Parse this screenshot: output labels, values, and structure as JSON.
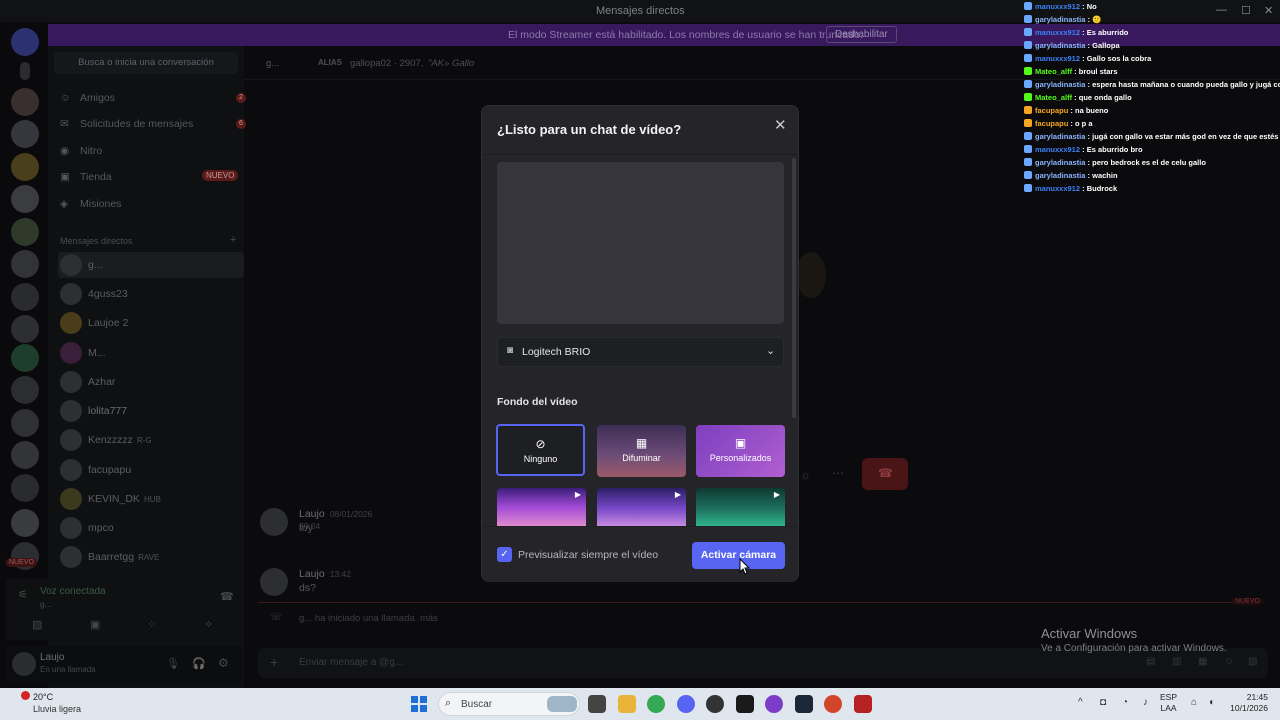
{
  "window": {
    "title": "Mensajes directos"
  },
  "banner": {
    "message": "El modo Streamer está habilitado. Los nombres de usuario se han truncado.",
    "button": "Deshabilitar"
  },
  "sidebar": {
    "search_placeholder": "Busca o inicia una conversación",
    "nav": [
      {
        "label": "Amigos",
        "icon": "friends-icon",
        "count": "2"
      },
      {
        "label": "Solicitudes de mensajes",
        "icon": "mail-icon",
        "count": "6"
      },
      {
        "label": "Nitro",
        "icon": "nitro-icon"
      },
      {
        "label": "Tienda",
        "icon": "shop-icon",
        "tag": "NUEVO"
      },
      {
        "label": "Misiones",
        "icon": "quest-icon"
      }
    ],
    "dm_header": "Mensajes directos",
    "dms": [
      {
        "name": "g...",
        "tag": ""
      },
      {
        "name": "4guss23",
        "tag": ""
      },
      {
        "name": "Laujoe 2",
        "tag": ""
      },
      {
        "name": "M...",
        "tag": ""
      },
      {
        "name": "Azhar",
        "tag": ""
      },
      {
        "name": "lolita777",
        "tag": ""
      },
      {
        "name": "Kenzzzzz",
        "tag": "R-G"
      },
      {
        "name": "facupapu",
        "tag": ""
      },
      {
        "name": "KEVIN_DK",
        "tag": "HUB"
      },
      {
        "name": "mpco",
        "tag": ""
      },
      {
        "name": "Baarretgg",
        "tag": "RAVE"
      }
    ],
    "voice_status": "Voz conectada",
    "voice_sub": "g...",
    "user_name": "Laujo",
    "user_status": "En una llamada"
  },
  "header": {
    "name": "g...",
    "alias_label": "ALIAS",
    "alias_value": "gallopa02 · 2907,",
    "alias_extra": "\"AK» Gallo"
  },
  "messages": [
    {
      "author": "Laujo",
      "time": "08/01/2026 20:04",
      "text": "toy"
    },
    {
      "author": "Laujo",
      "time": "13:42",
      "text": "ds?"
    }
  ],
  "call_notice": "g... ha iniciado una llamada. más",
  "composer_placeholder": "Enviar mensaje a @g...",
  "new_divider": "NUEVO",
  "overlay_chat": [
    {
      "user": "manuxxx912",
      "msg": "No",
      "color": "#3b82f6",
      "platform": "#6aa9ff"
    },
    {
      "user": "garyladinastia",
      "msg": "🙂",
      "color": "#8ab4ff",
      "platform": "#6aa9ff"
    },
    {
      "user": "manuxxx912",
      "msg": "Es aburrido",
      "color": "#3b82f6",
      "platform": "#6aa9ff"
    },
    {
      "user": "garyladinastia",
      "msg": "Gallopa",
      "color": "#8ab4ff",
      "platform": "#6aa9ff"
    },
    {
      "user": "manuxxx912",
      "msg": "Gallo sos la cobra",
      "color": "#3b82f6",
      "platform": "#6aa9ff"
    },
    {
      "user": "Mateo_alff",
      "msg": "broul stars",
      "color": "#53fc18",
      "platform": "#53fc18"
    },
    {
      "user": "garyladinastia",
      "msg": "espera hasta mañana o cuando pueda gallo y jugá con el",
      "color": "#8ab4ff",
      "platform": "#6aa9ff"
    },
    {
      "user": "Mateo_alff",
      "msg": "que onda gallo",
      "color": "#53fc18",
      "platform": "#53fc18"
    },
    {
      "user": "facupapu",
      "msg": "na bueno",
      "color": "#f5a623",
      "platform": "#f5a623"
    },
    {
      "user": "facupapu",
      "msg": "o p a",
      "color": "#f5a623",
      "platform": "#f5a623"
    },
    {
      "user": "garyladinastia",
      "msg": "jugá con gallo va estar más god en vez de que estés solo",
      "color": "#8ab4ff",
      "platform": "#6aa9ff"
    },
    {
      "user": "manuxxx912",
      "msg": "Es aburrido bro",
      "color": "#3b82f6",
      "platform": "#6aa9ff"
    },
    {
      "user": "garyladinastia",
      "msg": "pero bedrock es el de celu gallo",
      "color": "#8ab4ff",
      "platform": "#6aa9ff"
    },
    {
      "user": "garyladinastia",
      "msg": "wachin",
      "color": "#8ab4ff",
      "platform": "#6aa9ff"
    },
    {
      "user": "manuxxx912",
      "msg": "Budrock",
      "color": "#3b82f6",
      "platform": "#6aa9ff"
    }
  ],
  "modal": {
    "title": "¿Listo para un chat de vídeo?",
    "camera": "Logitech BRIO",
    "bg_title": "Fondo del vídeo",
    "bg_options": [
      {
        "label": "Ninguno",
        "icon": "none-icon",
        "glyph": "⊘"
      },
      {
        "label": "Difuminar",
        "icon": "blur-icon",
        "glyph": "▦"
      },
      {
        "label": "Personalizados",
        "icon": "custom-image-icon",
        "glyph": "▣"
      }
    ],
    "checkbox_label": "Previsualizar siempre el vídeo",
    "checkbox_checked": true,
    "activate_button": "Activar cámara"
  },
  "watermark": {
    "line1": "Activar Windows",
    "line2": "Ve a Configuración para activar Windows."
  },
  "taskbar": {
    "weather_temp": "20°C",
    "weather_desc": "Lluvia ligera",
    "search": "Buscar",
    "lang1": "ESP",
    "lang2": "LAA",
    "time": "21:45",
    "date": "10/1/2026"
  }
}
